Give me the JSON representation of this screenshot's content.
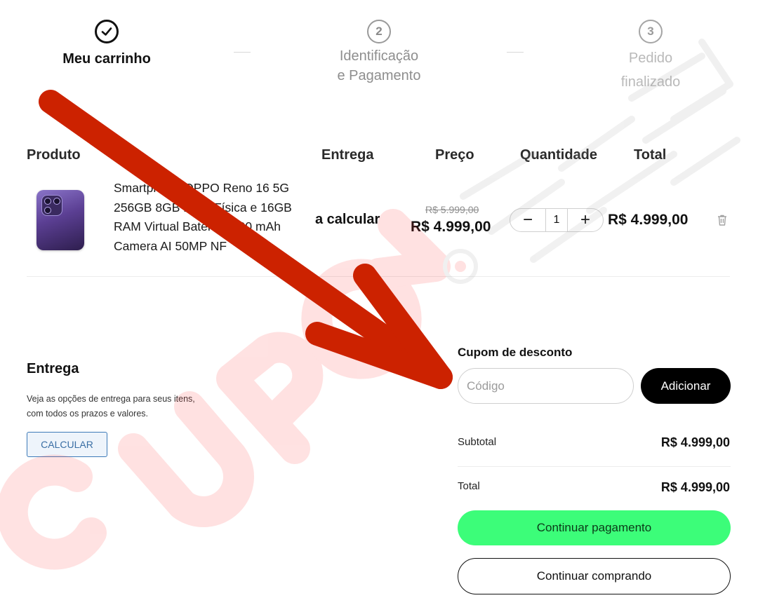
{
  "stepper": {
    "steps": [
      {
        "number": "",
        "label_line1": "Meu carrinho",
        "label_line2": "",
        "state": "completed"
      },
      {
        "number": "2",
        "label_line1": "Identificação",
        "label_line2": "e Pagamento",
        "state": "inactive"
      },
      {
        "number": "3",
        "label_line1": "Pedido",
        "label_line2": "finalizado",
        "state": "inactive"
      }
    ]
  },
  "table": {
    "headers": {
      "product": "Produto",
      "delivery": "Entrega",
      "price": "Preço",
      "quantity": "Quantidade",
      "total": "Total"
    },
    "rows": [
      {
        "name": "Smartphone OPPO Reno 16 5G 256GB 8GB RAM Física e 16GB RAM Virtual Bateria 6200 mAh Camera AI 50MP NF",
        "delivery": "a calcular",
        "old_price": "R$ 5.999,00",
        "price": "R$ 4.999,00",
        "quantity": "1",
        "total": "R$ 4.999,00"
      }
    ]
  },
  "qty_controls": {
    "decrease": "−",
    "increase": "+"
  },
  "delivery_box": {
    "title": "Entrega",
    "text_line1": "Veja as opções de entrega para seus itens,",
    "text_line2": "com todos os prazos e valores.",
    "button": "CALCULAR"
  },
  "coupon": {
    "title": "Cupom de desconto",
    "placeholder": "Código",
    "button": "Adicionar"
  },
  "summary": {
    "subtotal_label": "Subtotal",
    "subtotal_value": "R$ 4.999,00",
    "total_label": "Total",
    "total_value": "R$ 4.999,00"
  },
  "actions": {
    "continue_payment": "Continuar pagamento",
    "continue_shopping": "Continuar comprando"
  },
  "colors": {
    "accent_green": "#3cfd79",
    "annotation_arrow": "#cc2200",
    "watermark": "#ff5a5a"
  }
}
